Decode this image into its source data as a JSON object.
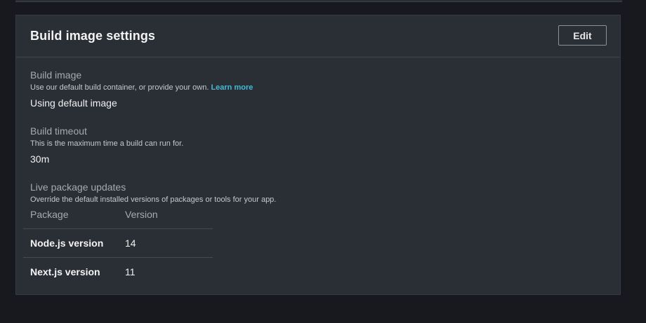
{
  "card": {
    "title": "Build image settings",
    "edit_label": "Edit"
  },
  "build_image": {
    "label": "Build image",
    "description": "Use our default build container, or provide your own.",
    "learn_more": "Learn more",
    "value": "Using default image"
  },
  "build_timeout": {
    "label": "Build timeout",
    "description": "This is the maximum time a build can run for.",
    "value": "30m"
  },
  "live_package_updates": {
    "label": "Live package updates",
    "description": "Override the default installed versions of packages or tools for your app.",
    "columns": [
      "Package",
      "Version"
    ],
    "rows": [
      {
        "package": "Node.js version",
        "version": "14"
      },
      {
        "package": "Next.js version",
        "version": "11"
      }
    ]
  },
  "colors": {
    "background": "#17191e",
    "card": "#2a2e35",
    "link": "#44b9d6"
  }
}
